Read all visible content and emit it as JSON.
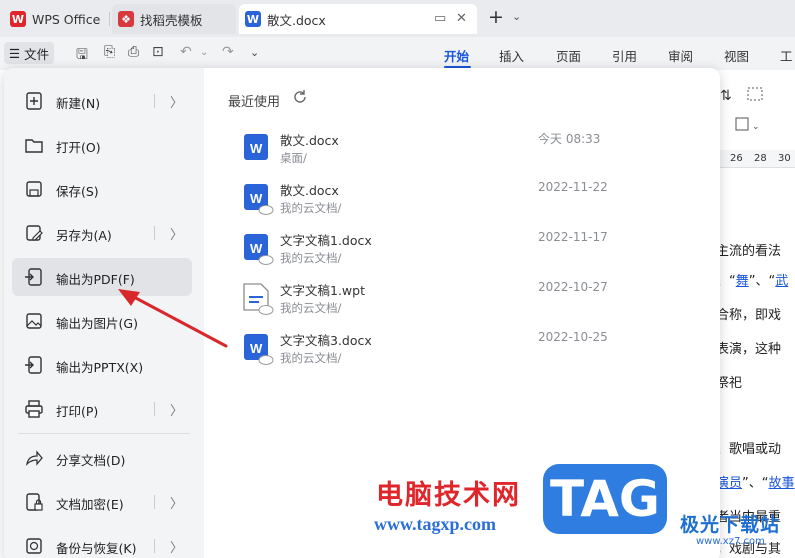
{
  "titlebar": {
    "tabs": [
      {
        "label": "WPS Office"
      },
      {
        "label": "找稻壳模板"
      },
      {
        "label": "散文.docx"
      }
    ],
    "new_tab": "+"
  },
  "toolbar": {
    "file_menu_label": "文件",
    "ribbon_tabs": [
      "开始",
      "插入",
      "页面",
      "引用",
      "审阅",
      "视图",
      "工"
    ]
  },
  "file_menu": {
    "items": [
      {
        "label": "新建(N)",
        "icon": "new-doc-icon"
      },
      {
        "label": "打开(O)",
        "icon": "folder-icon"
      },
      {
        "label": "保存(S)",
        "icon": "save-icon"
      },
      {
        "label": "另存为(A)",
        "icon": "save-as-icon"
      },
      {
        "label": "输出为PDF(F)",
        "icon": "export-pdf-icon"
      },
      {
        "label": "输出为图片(G)",
        "icon": "export-image-icon"
      },
      {
        "label": "输出为PPTX(X)",
        "icon": "export-pptx-icon"
      },
      {
        "label": "打印(P)",
        "icon": "print-icon"
      },
      {
        "label": "分享文档(D)",
        "icon": "share-icon"
      },
      {
        "label": "文档加密(E)",
        "icon": "encrypt-icon"
      },
      {
        "label": "备份与恢复(K)",
        "icon": "backup-icon"
      }
    ]
  },
  "recent": {
    "title": "最近使用",
    "files": [
      {
        "name": "散文.docx",
        "location": "桌面/",
        "date": "今天  08:33",
        "type": "docx"
      },
      {
        "name": "散文.docx",
        "location": "我的云文档/",
        "date": "2022-11-22",
        "type": "docx"
      },
      {
        "name": "文字文稿1.docx",
        "location": "我的云文档/",
        "date": "2022-11-17",
        "type": "docx"
      },
      {
        "name": "文字文稿1.wpt",
        "location": "我的云文档/",
        "date": "2022-10-27",
        "type": "wpt"
      },
      {
        "name": "文字文稿3.docx",
        "location": "我的云文档/",
        "date": "2022-10-25",
        "type": "docx"
      }
    ]
  },
  "document_snippets": {
    "ruler": [
      "26",
      "28",
      "30"
    ],
    "lines": [
      "主流的看法",
      "、“",
      "舞",
      "”、“",
      "武",
      "合称，即戏",
      "表演，这种",
      "祭祀",
      "、歌唱或动",
      "演员",
      "”、“",
      "故事",
      "者当中最重",
      "，戏剧与其"
    ]
  },
  "watermark": {
    "site_name": "电脑技术网",
    "url": "www.tagxp.com",
    "tag": "TAG",
    "brand": "极光下载站",
    "brand_url": "www.xz7.com"
  },
  "colors": {
    "accent": "#1a56db",
    "arrow": "#d9282c",
    "wps_red": "#e0262b",
    "doc_blue": "#2b64d8"
  }
}
